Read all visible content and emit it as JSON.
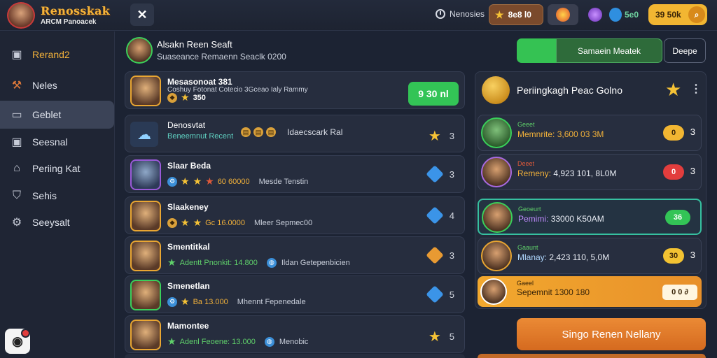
{
  "brand": {
    "title": "Renosskak",
    "subtitle": "ARCM Panoacek"
  },
  "topbar": {
    "status_label": "Nenosies",
    "star_value": "8e8 l0",
    "gold_value": "39 50k",
    "shield_value": "5e0"
  },
  "sidebar": {
    "items": [
      {
        "label": "Rerand2",
        "icon": "box-icon",
        "active": false
      },
      {
        "label": "Neles",
        "icon": "hammer-icon",
        "active": false
      },
      {
        "label": "Geblet",
        "icon": "chat-icon",
        "active": true
      },
      {
        "label": "Seesnal",
        "icon": "box-icon",
        "active": false
      },
      {
        "label": "Periing Kat",
        "icon": "home-icon",
        "active": false
      },
      {
        "label": "Sehis",
        "icon": "shield-icon",
        "active": false
      },
      {
        "label": "Seeysalt",
        "icon": "gear-icon",
        "active": false
      }
    ]
  },
  "profile": {
    "name": "Alsakn Reen Seaft",
    "subtitle": "Suaseance Remaenn Seaclk 0200"
  },
  "list": {
    "rows": [
      {
        "name": "Mesasonoat 381",
        "line": "Coshuy Fotonat Cotecio 3Gceao Ialy Rammy",
        "sub": "350",
        "right": "",
        "button": "9 30 nl"
      },
      {
        "name": "Denosvtat",
        "line": "Beneemnut Recent",
        "desc": "Idaecscark Ral",
        "right": "3"
      },
      {
        "name": "Slaar Beda",
        "line": "60 60000",
        "desc": "Mesde Tenstin",
        "right": "3"
      },
      {
        "name": "Slaakeney",
        "line": "Gc 16.0000",
        "desc": "Mleer Sepmec00",
        "right": "4"
      },
      {
        "name": "Smentitkal",
        "line": "Adentt Pnonkit: 14.800",
        "desc": "Ildan Getepenbicien",
        "right": "3"
      },
      {
        "name": "Smenetlan",
        "line": "Ba 13.000",
        "desc": "Mhennt Fepenedale",
        "right": "5"
      },
      {
        "name": "Mamontee",
        "line": "Adenl Feoene: 13.000",
        "desc": "Menobic",
        "right": "5"
      }
    ]
  },
  "right": {
    "tab_label": "Samaein Meatek",
    "outline_btn": "Deepe",
    "lb_title": "Periingkagh Peac Golno",
    "rows": [
      {
        "tag": "Geeet",
        "text_a": "Memnrite:",
        "text_b": "3,600 03 3M",
        "badge": "0",
        "rank": "3"
      },
      {
        "tag": "Deeet",
        "text_a": "Remeny:",
        "text_b": "4,923 101, 8L0M",
        "badge": "0",
        "rank": "3"
      },
      {
        "tag": "Geoeurt",
        "text_a": "Pemimi:",
        "text_b": "33000 K50AM",
        "badge": "36",
        "rank": "3"
      },
      {
        "tag": "Gaaunt",
        "text_a": "Mlanay:",
        "text_b": "2,423 110, 5,0M",
        "badge": "30",
        "rank": "3"
      },
      {
        "tag": "Gaeel",
        "text_a": "Sepemnit",
        "text_b": "1300 180",
        "gold": "0 0 ∂"
      }
    ],
    "cta": "Singo Renen Nellany"
  },
  "colors": {
    "accent_green": "#33c456",
    "accent_gold": "#f2b632",
    "accent_orange": "#e8902a",
    "bg": "#1c2333"
  }
}
